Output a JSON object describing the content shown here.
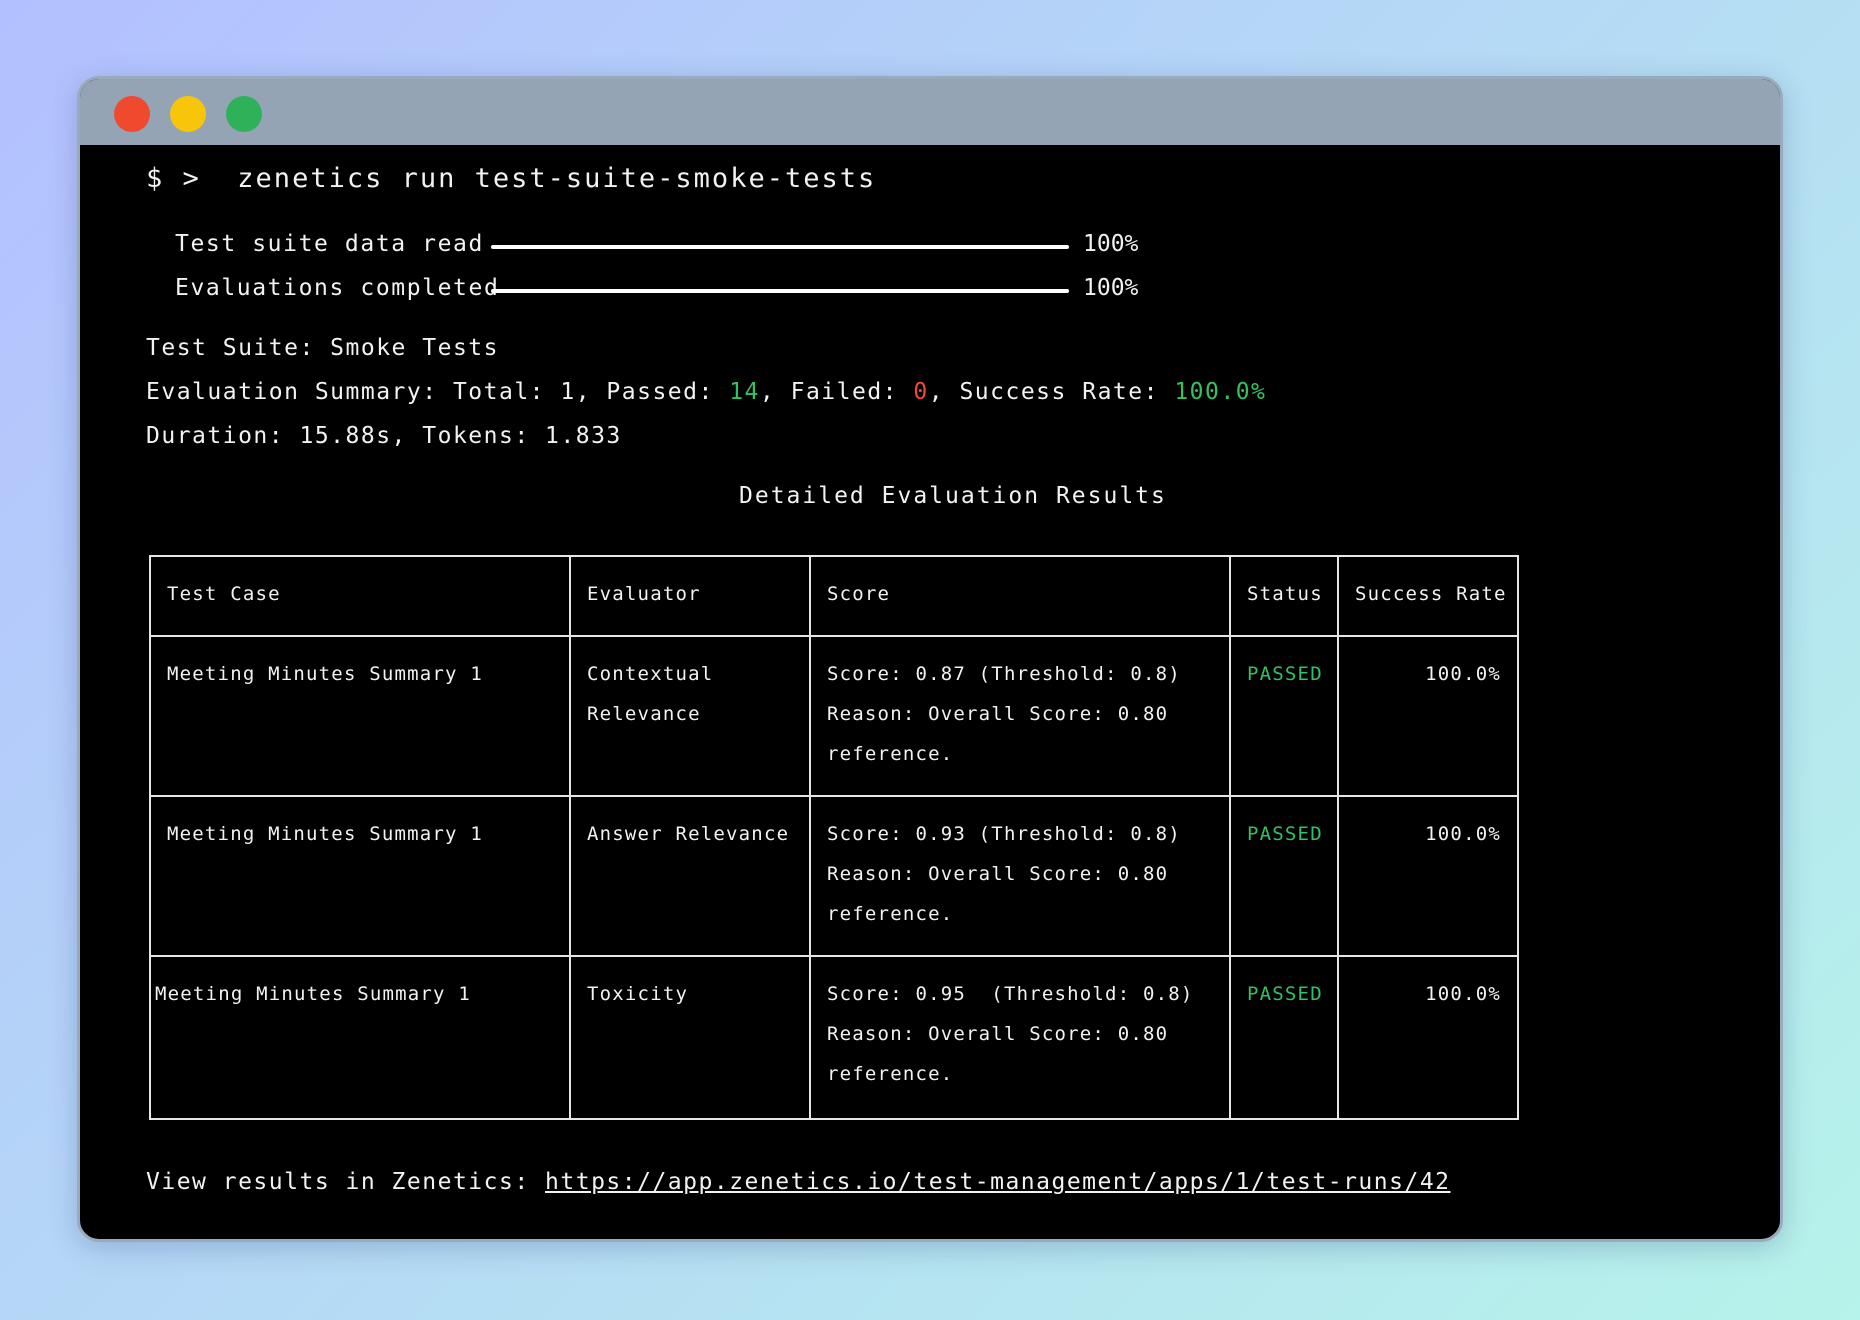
{
  "window": {
    "traffic_lights": [
      "red",
      "yellow",
      "green"
    ],
    "colors": {
      "red": "#f04a2e",
      "yellow": "#f7c60a",
      "green": "#2fb15a"
    }
  },
  "terminal": {
    "prompt": "$ >",
    "command": "zenetics run test-suite-smoke-tests",
    "progress": [
      {
        "label": "Test suite data read",
        "percent_text": "100%",
        "value": 1.0
      },
      {
        "label": "Evaluations completed",
        "percent_text": "100%",
        "value": 1.0
      }
    ],
    "suite_line": "Test Suite: Smoke Tests",
    "summary": {
      "prefix": "Evaluation Summary: Total: 1, Passed: ",
      "passed": "14",
      "mid1": ", Failed: ",
      "failed": "0",
      "mid2": ", Success Rate: ",
      "rate": "100.0%"
    },
    "duration_line": "Duration: 15.88s, Tokens: 1.833",
    "table_title": "Detailed Evaluation Results",
    "table": {
      "headers": [
        "Test Case",
        "Evaluator",
        "Score",
        "Status",
        "Success Rate"
      ],
      "rows": [
        {
          "test_case": "Meeting Minutes Summary 1",
          "evaluator": [
            "Contextual",
            "Relevance"
          ],
          "score": [
            "Score: 0.87 (Threshold: 0.8)",
            "Reason: Overall Score: 0.80",
            "reference."
          ],
          "status": "PASSED",
          "rate": "100.0%"
        },
        {
          "test_case": "Meeting Minutes Summary 1",
          "evaluator": [
            "Answer Relevance"
          ],
          "score": [
            "Score: 0.93 (Threshold: 0.8)",
            "Reason: Overall Score: 0.80",
            "reference."
          ],
          "status": "PASSED",
          "rate": "100.0%"
        },
        {
          "test_case": "Meeting Minutes Summary 1",
          "evaluator": [
            "Toxicity"
          ],
          "score": [
            "Score: 0.95  (Threshold: 0.8)",
            "Reason: Overall Score: 0.80",
            "reference."
          ],
          "status": "PASSED",
          "rate": "100.0%"
        }
      ]
    },
    "footer": {
      "prefix": "View results in Zenetics: ",
      "url": "https://app.zenetics.io/test-management/apps/1/test-runs/42"
    }
  }
}
